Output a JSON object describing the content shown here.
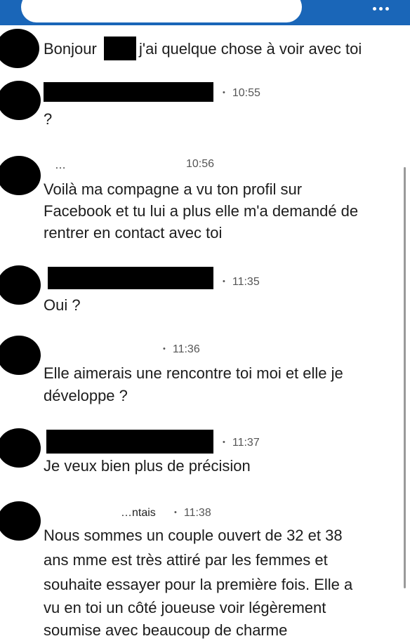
{
  "messages": [
    {
      "text_before": "Bonjour",
      "text_after": "j'ai quelque chose à voir avec toi"
    },
    {
      "time": "10:55",
      "text": "?"
    },
    {
      "time": "10:56",
      "sender_fragment": "…",
      "lines": [
        "Voilà ma compagne a vu ton profil sur",
        "Facebook et tu lui a plus elle m'a demandé de",
        "rentrer en contact avec toi"
      ]
    },
    {
      "time": "11:35",
      "text": "Oui ?"
    },
    {
      "time": "11:36",
      "lines": [
        "Elle aimerais une rencontre toi moi et elle je",
        "développe ?"
      ]
    },
    {
      "time": "11:37",
      "text": "Je veux bien plus de précision"
    },
    {
      "time": "11:38",
      "sender_fragment": "…ntais",
      "lines": [
        "Nous sommes un couple ouvert de 32 et 38",
        "ans mme est très attiré par les femmes et",
        "souhaite essayer pour la première fois. Elle a",
        "vu en toi un côté joueuse voir légèrement",
        "soumise avec beaucoup de charme"
      ]
    }
  ],
  "colors": {
    "header": "#1a66b8",
    "text": "#1c1c1c",
    "meta": "#555555"
  },
  "icons": {
    "menu": "more-horizontal-icon",
    "bullet": "•"
  }
}
